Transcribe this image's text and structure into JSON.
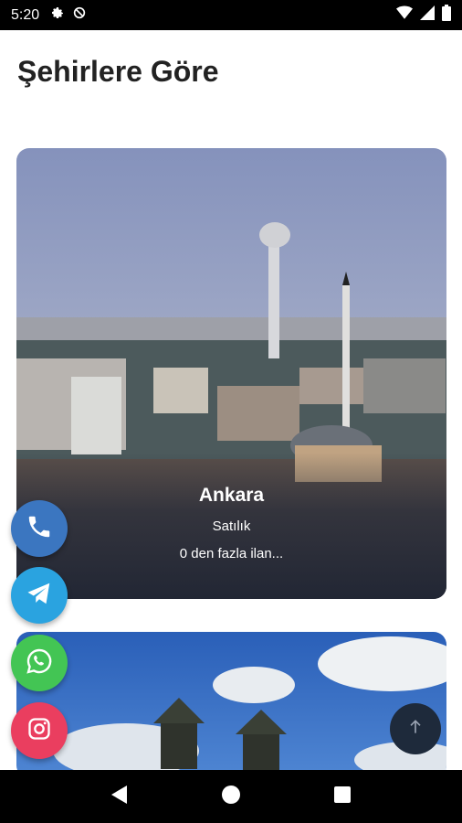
{
  "status_bar": {
    "time": "5:20",
    "icons_left": [
      "gear-icon",
      "data-saver-icon"
    ],
    "icons_right": [
      "wifi-icon",
      "signal-icon",
      "battery-icon"
    ]
  },
  "page": {
    "title": "Şehirlere Göre"
  },
  "cards": [
    {
      "city": "Ankara",
      "type": "Satılık",
      "count_text": "0 den fazla ilan..."
    }
  ],
  "fabs": [
    "phone-icon",
    "telegram-icon",
    "whatsapp-icon",
    "instagram-icon"
  ],
  "scroll_top_icon": "arrow-up-icon",
  "nav_bar": {
    "icons": [
      "back-triangle-icon",
      "home-circle-icon",
      "recents-square-icon"
    ]
  },
  "colors": {
    "phone": "#3b76c0",
    "telegram": "#2aa3e0",
    "whatsapp": "#43c554",
    "instagram": "#ea3e5f",
    "scroll_top": "#1e2a3b"
  }
}
